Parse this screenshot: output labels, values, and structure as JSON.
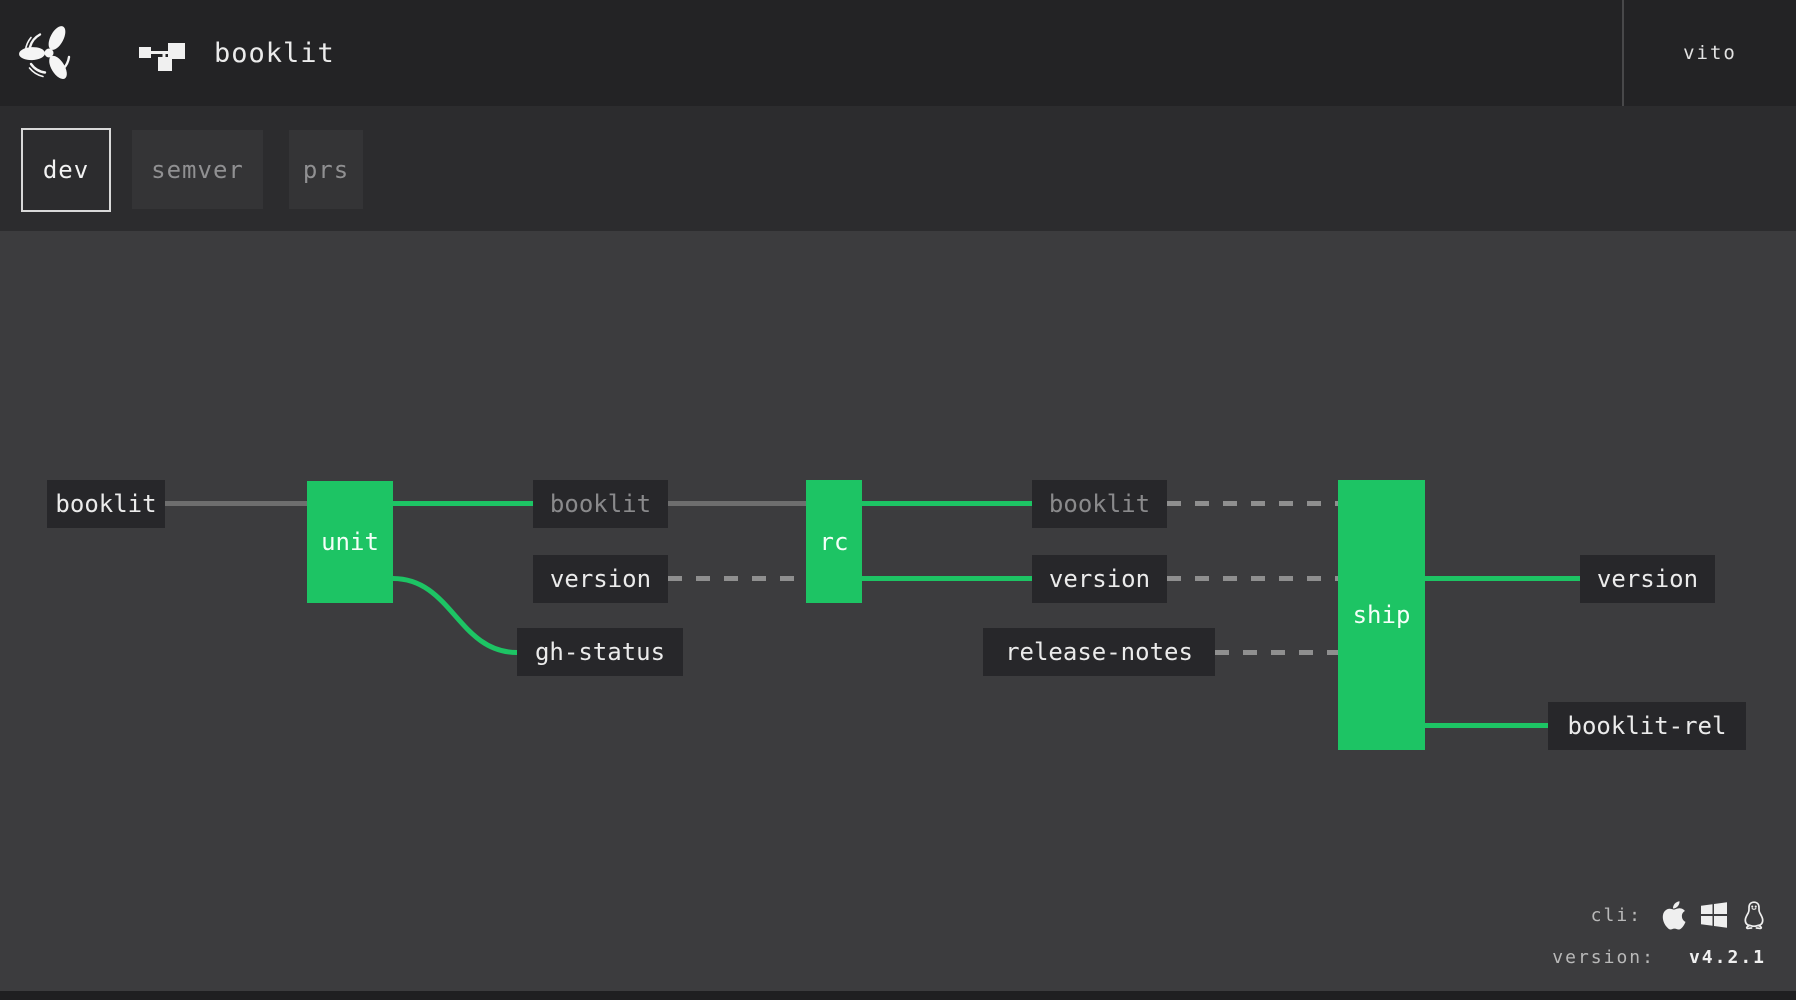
{
  "header": {
    "title": "booklit",
    "user": "vito",
    "logo_icon": "concourse-logo",
    "breadcrumb_icon": "pipeline-graph-icon"
  },
  "groups": {
    "tabs": [
      {
        "label": "dev",
        "active": true
      },
      {
        "label": "semver",
        "active": false
      },
      {
        "label": "prs",
        "active": false
      }
    ]
  },
  "graph": {
    "jobs": [
      {
        "id": "unit",
        "label": "unit",
        "status": "succeeded"
      },
      {
        "id": "rc",
        "label": "rc",
        "status": "succeeded"
      },
      {
        "id": "ship",
        "label": "ship",
        "status": "succeeded"
      }
    ],
    "resources": [
      {
        "id": "booklit-input",
        "label": "booklit",
        "faded": false
      },
      {
        "id": "booklit-after-unit",
        "label": "booklit",
        "faded": true
      },
      {
        "id": "version-before-rc",
        "label": "version",
        "faded": false
      },
      {
        "id": "gh-status",
        "label": "gh-status",
        "faded": false
      },
      {
        "id": "booklit-after-rc",
        "label": "booklit",
        "faded": true
      },
      {
        "id": "version-after-rc",
        "label": "version",
        "faded": false
      },
      {
        "id": "release-notes",
        "label": "release-notes",
        "faded": false
      },
      {
        "id": "version-output",
        "label": "version",
        "faded": false
      },
      {
        "id": "booklit-rel",
        "label": "booklit-rel",
        "faded": false
      }
    ],
    "connections": [
      {
        "from": "booklit-input",
        "to": "unit",
        "style": "solid-gray"
      },
      {
        "from": "unit",
        "to": "booklit-after-unit",
        "style": "solid-green"
      },
      {
        "from": "unit",
        "to": "gh-status",
        "style": "solid-green-curve"
      },
      {
        "from": "booklit-after-unit",
        "to": "rc",
        "style": "solid-gray"
      },
      {
        "from": "version-before-rc",
        "to": "rc",
        "style": "dashed-gray"
      },
      {
        "from": "rc",
        "to": "booklit-after-rc",
        "style": "solid-green"
      },
      {
        "from": "rc",
        "to": "version-after-rc",
        "style": "solid-green"
      },
      {
        "from": "booklit-after-rc",
        "to": "ship",
        "style": "dashed-gray"
      },
      {
        "from": "version-after-rc",
        "to": "ship",
        "style": "dashed-gray"
      },
      {
        "from": "release-notes",
        "to": "ship",
        "style": "dashed-gray"
      },
      {
        "from": "ship",
        "to": "version-output",
        "style": "solid-green"
      },
      {
        "from": "ship",
        "to": "booklit-rel",
        "style": "solid-green"
      }
    ]
  },
  "footer": {
    "cli_label": "cli:",
    "cli_icons": [
      "apple-icon",
      "windows-icon",
      "linux-icon"
    ],
    "version_label": "version:",
    "version_value": "v4.2.1"
  },
  "colors": {
    "job_succeeded_green": "#1dc464",
    "header_bg": "#232325",
    "groups_bar_bg": "#2c2c2e",
    "main_bg": "#3c3c3e",
    "node_bg": "#27272a",
    "solid_line_gray": "#6e6e6e",
    "dashed_line_gray": "#8f8f8f",
    "faded_resource_text": "#8a8a8c"
  }
}
